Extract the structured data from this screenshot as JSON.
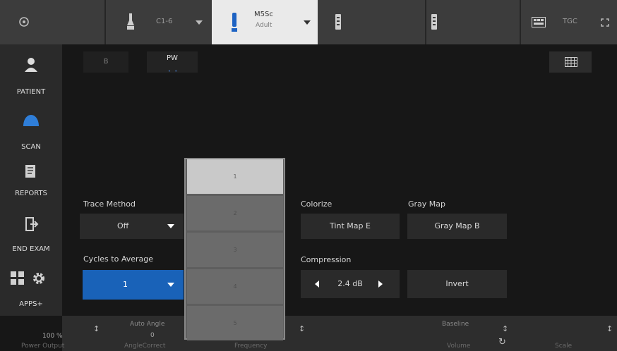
{
  "topbar": {
    "probe1": {
      "name": "C1-6"
    },
    "probe_active": {
      "name": "M5Sc",
      "preset": "Adult"
    },
    "tgc_label": "TGC",
    "colors": {
      "bar": "#3c3c3c",
      "active": "#eaeaea",
      "accent": "#1962b8"
    }
  },
  "sidebar": {
    "items": [
      {
        "label": "PATIENT",
        "icon": "patient-icon"
      },
      {
        "label": "SCAN",
        "icon": "scan-icon"
      },
      {
        "label": "REPORTS",
        "icon": "reports-icon"
      },
      {
        "label": "END EXAM",
        "icon": "end-exam-icon"
      },
      {
        "label": "APPS+",
        "icon": "apps-icon"
      }
    ]
  },
  "tabs": {
    "b": "B",
    "pw": "PW",
    "pw_indicator": "• •"
  },
  "controls": {
    "trace_method": {
      "label": "Trace Method",
      "value": "Off"
    },
    "cycles_to_average": {
      "label": "Cycles to Average",
      "value": "1"
    },
    "colorize": {
      "label": "Colorize",
      "value": "Tint Map E"
    },
    "gray_map": {
      "label": "Gray Map",
      "value": "Gray Map B"
    },
    "compression": {
      "label": "Compression",
      "value": "2.4 dB"
    },
    "invert": {
      "label": "Invert"
    }
  },
  "dropdown": {
    "options": [
      "1",
      "2",
      "3",
      "4",
      "5"
    ],
    "selected_index": 0
  },
  "bottombar": {
    "power_output_value": "100 %",
    "power_output_label": "Power Output",
    "auto_angle_label": "Auto Angle",
    "angle_value": "0",
    "angle_correct_label": "AngleCorrect",
    "frequency_label": "Frequency",
    "baseline_label": "Baseline",
    "volume_label": "Volume",
    "scale_label": "Scale"
  }
}
